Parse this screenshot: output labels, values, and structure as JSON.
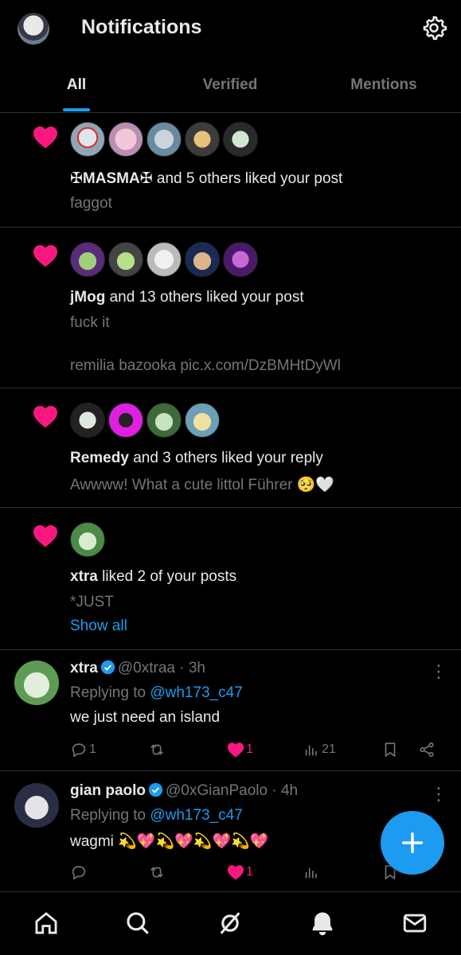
{
  "header": {
    "title": "Notifications",
    "avatar": "profile-avatar",
    "settings_icon": "gear-icon"
  },
  "tabs": [
    {
      "label": "All",
      "active": true
    },
    {
      "label": "Verified",
      "active": false
    },
    {
      "label": "Mentions",
      "active": false
    }
  ],
  "notifications": [
    {
      "icon": "heart-icon",
      "avatar_count": 5,
      "actor": "✠MASMA✠",
      "action": " and 5 others liked your post",
      "post_text": "faggot"
    },
    {
      "icon": "heart-icon",
      "avatar_count": 5,
      "actor": "jMog",
      "action": " and 13 others liked your post",
      "post_text": "fuck it",
      "post_text_2": "remilia bazooka pic.x.com/DzBMHtDyWl"
    },
    {
      "icon": "heart-icon",
      "avatar_count": 4,
      "actor": "Remedy",
      "action": " and 3 others liked your reply",
      "post_text": "Awwww! What a cute littol Führer 🥺🤍"
    },
    {
      "icon": "heart-icon",
      "avatar_count": 1,
      "actor": "xtra",
      "action": " liked 2 of your posts",
      "post_text": "*JUST",
      "link": "Show all"
    }
  ],
  "tweets": [
    {
      "name": "xtra",
      "handle": "@0xtraa · 3h",
      "replying_label": "Replying to ",
      "replying_to": "@wh173_c47",
      "text": "we just need an island",
      "replies": "1",
      "reposts": "",
      "likes": "1",
      "views": "21"
    },
    {
      "name": "gian paolo",
      "handle": "@0xGianPaolo · 4h",
      "replying_label": "Replying to ",
      "replying_to": "@wh173_c47",
      "text": "wagmi 💫💖💫💖💫💖💫💖",
      "replies": "",
      "reposts": "",
      "likes": "1",
      "views": ""
    }
  ],
  "fab": {
    "icon": "plus-icon"
  },
  "bottom_nav": [
    {
      "icon": "home-icon"
    },
    {
      "icon": "search-icon"
    },
    {
      "icon": "grok-icon"
    },
    {
      "icon": "bell-icon"
    },
    {
      "icon": "mail-icon"
    }
  ],
  "colors": {
    "accent": "#1d9bf0",
    "like": "#f91880",
    "muted": "#71767b",
    "text": "#e7e9ea",
    "bg": "#000000"
  }
}
